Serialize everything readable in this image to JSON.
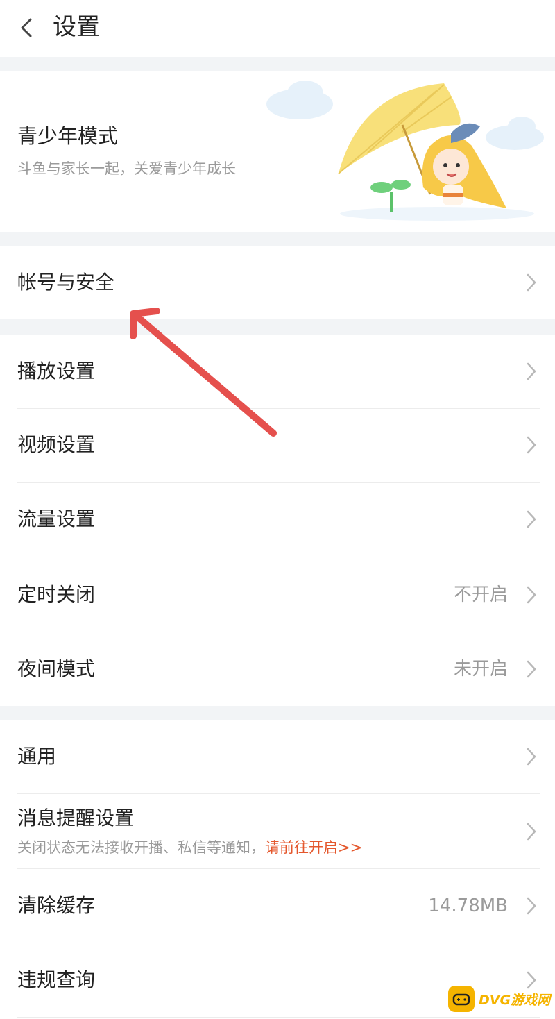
{
  "header": {
    "title": "设置",
    "back_icon": "chevron-left-icon"
  },
  "youth_mode": {
    "title": "青少年模式",
    "subtitle": "斗鱼与家长一起，关爱青少年成长"
  },
  "sections": {
    "account": {
      "label": "帐号与安全"
    },
    "playback": {
      "label": "播放设置"
    },
    "video": {
      "label": "视频设置"
    },
    "traffic": {
      "label": "流量设置"
    },
    "timer": {
      "label": "定时关闭",
      "value": "不开启"
    },
    "night": {
      "label": "夜间模式",
      "value": "未开启"
    },
    "general": {
      "label": "通用"
    },
    "message": {
      "label": "消息提醒设置",
      "subtitle": "关闭状态无法接收开播、私信等通知，",
      "link": "请前往开启>>"
    },
    "cache": {
      "label": "清除缓存",
      "value": "14.78MB"
    },
    "violation": {
      "label": "违规查询"
    }
  },
  "watermark": {
    "text": "DVG游戏网"
  },
  "colors": {
    "accent_link": "#e4572c",
    "annotation_arrow": "#e5504d",
    "section_gap": "#f2f4f6"
  }
}
